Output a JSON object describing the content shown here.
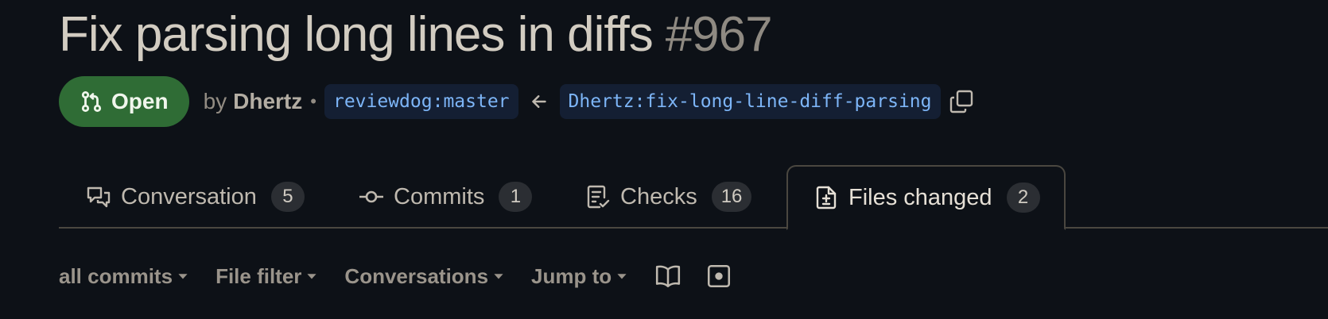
{
  "pr": {
    "title": "Fix parsing long lines in diffs",
    "number": "#967",
    "state": "Open",
    "by_label": "by",
    "author": "Dhertz",
    "separator": "•",
    "base_branch": "reviewdog:master",
    "head_branch": "Dhertz:fix-long-line-diff-parsing"
  },
  "tabs": [
    {
      "label": "Conversation",
      "count": "5",
      "icon": "comment-discussion-icon"
    },
    {
      "label": "Commits",
      "count": "1",
      "icon": "git-commit-icon"
    },
    {
      "label": "Checks",
      "count": "16",
      "icon": "checklist-icon"
    },
    {
      "label": "Files changed",
      "count": "2",
      "icon": "file-diff-icon",
      "active": true
    }
  ],
  "toolbar": {
    "commits": "all commits",
    "file_filter": "File filter",
    "conversations": "Conversations",
    "jump_to": "Jump to"
  },
  "colors": {
    "background": "#0d1117",
    "open_badge": "#2f6c35",
    "branch_text": "#7db5f7"
  }
}
